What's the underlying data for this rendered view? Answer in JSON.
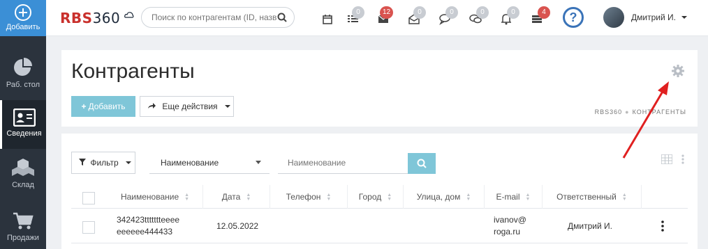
{
  "sidebar": {
    "items": [
      {
        "label": "Добавить"
      },
      {
        "label": "Раб. стол"
      },
      {
        "label": "Сведения"
      },
      {
        "label": "Склад"
      },
      {
        "label": "Продажи"
      }
    ]
  },
  "topbar": {
    "logo_letters": "RBS",
    "logo_numbers": "360",
    "search_placeholder": "Поиск по контрагентам (ID, назв",
    "badges": {
      "list": "0",
      "mail": "12",
      "mail_open": "0",
      "chat": "0",
      "chat2": "0",
      "bell": "0",
      "stack": "4"
    },
    "help_label": "?",
    "user_name": "Дмитрий И."
  },
  "header": {
    "title": "Контрагенты",
    "add_label": "Добавить",
    "more_label": "Еще действия",
    "breadcrumb": [
      "RBS360",
      "КОНТРАГЕНТЫ"
    ]
  },
  "filters": {
    "filter_label": "Фильтр",
    "field_selected": "Наименование",
    "input_placeholder": "Наименование"
  },
  "table": {
    "columns": [
      "Наименование",
      "Дата",
      "Телефон",
      "Город",
      "Улица, дом",
      "E-mail",
      "Ответственный"
    ],
    "rows": [
      {
        "name_line1": "342423ttttttteeee",
        "name_line2": "eeeeee444433",
        "date": "12.05.2022",
        "phone": "",
        "city": "",
        "street": "",
        "email_line1": "ivanov@",
        "email_line2": "roga.ru",
        "owner": "Дмитрий И."
      }
    ]
  },
  "colors": {
    "accent": "#7fc6d8",
    "sidebar": "#2b333d",
    "primary": "#3b8fd6",
    "badge_red": "#d9534f",
    "arrow": "#e02020"
  }
}
